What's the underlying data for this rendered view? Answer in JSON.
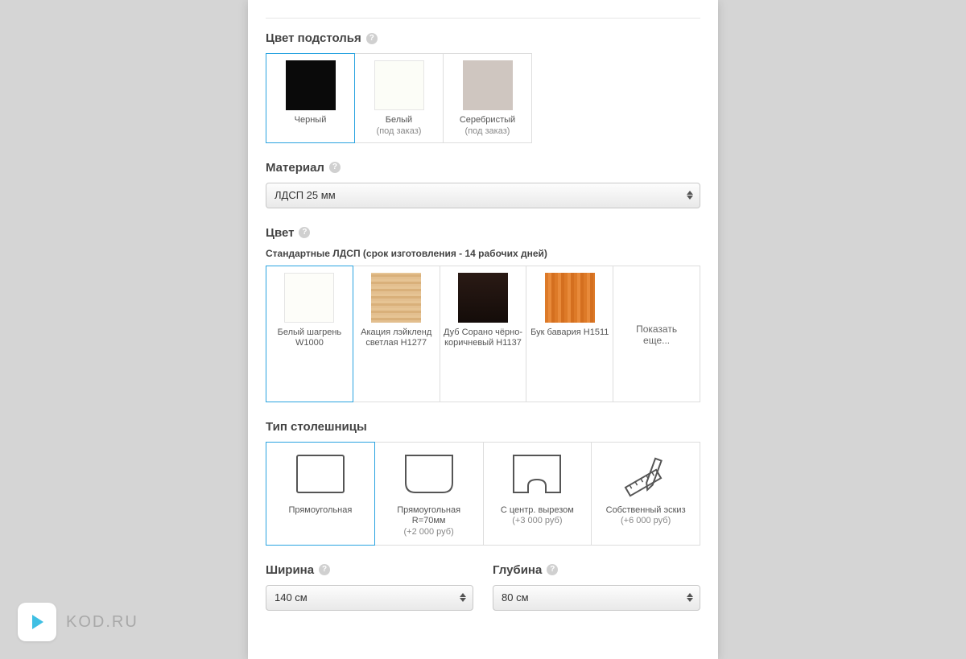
{
  "logo_text": "KOD.RU",
  "sections": {
    "base_color": {
      "title": "Цвет подстолья",
      "options": [
        {
          "label": "Черный",
          "sublabel": "",
          "color": "#0a0a0a",
          "selected": true
        },
        {
          "label": "Белый",
          "sublabel": "(под заказ)",
          "color": "#fcfdf7",
          "border": true,
          "selected": false
        },
        {
          "label": "Серебристый",
          "sublabel": "(под заказ)",
          "color": "#cfc6c0",
          "selected": false
        }
      ]
    },
    "material": {
      "title": "Материал",
      "value": "ЛДСП 25 мм"
    },
    "color": {
      "title": "Цвет",
      "subtitle": "Стандартные ЛДСП (срок изготовления - 14 рабочих дней)",
      "show_more": "Показать\nеще...",
      "options": [
        {
          "label": "Белый шагрень W1000",
          "swatch_class": "",
          "color": "#fdfdf9",
          "border": true,
          "selected": true
        },
        {
          "label": "Акация лэйкленд светлая H1277",
          "swatch_class": "wood-light",
          "selected": false
        },
        {
          "label": "Дуб Сорано чёрно-коричневый H1137",
          "swatch_class": "wood-dark",
          "selected": false
        },
        {
          "label": "Бук бавария H1511",
          "swatch_class": "wood-orange",
          "selected": false
        }
      ]
    },
    "tabletop_type": {
      "title": "Тип столешницы",
      "options": [
        {
          "label": "Прямоугольная",
          "sublabel": "",
          "icon": "rect",
          "selected": true
        },
        {
          "label": "Прямоугольная R=70мм",
          "sublabel": "(+2 000 руб)",
          "icon": "rect-rounded",
          "selected": false
        },
        {
          "label": "С центр. вырезом",
          "sublabel": "(+3 000 руб)",
          "icon": "rect-notch",
          "selected": false
        },
        {
          "label": "Собственный эскиз",
          "sublabel": "(+6 000 руб)",
          "icon": "sketch",
          "selected": false
        }
      ]
    },
    "width": {
      "title": "Ширина",
      "value": "140 см"
    },
    "depth": {
      "title": "Глубина",
      "value": "80 см"
    }
  }
}
